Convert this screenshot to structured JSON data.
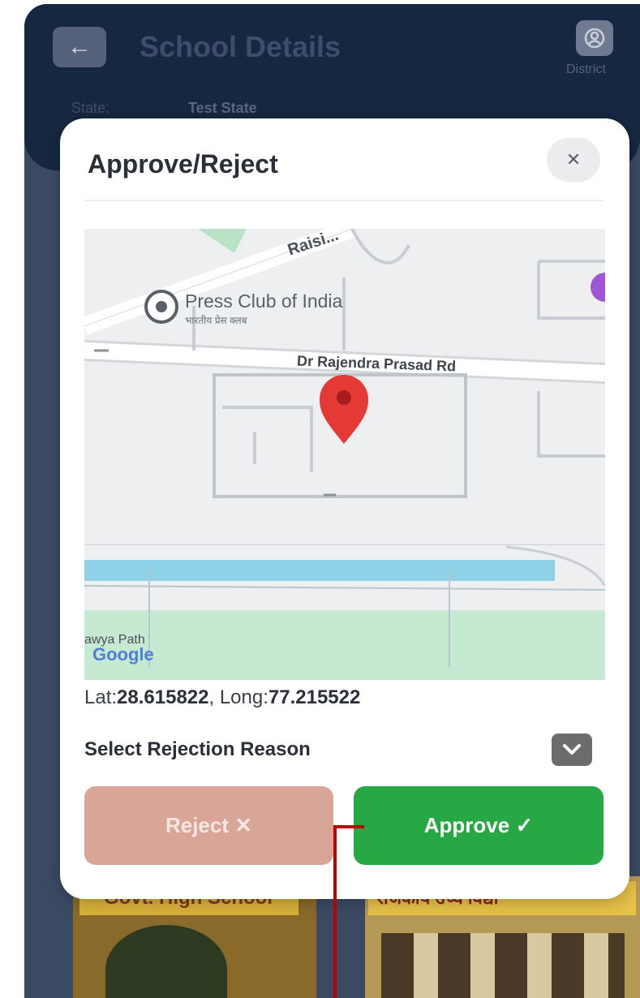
{
  "header": {
    "back_icon": "arrow-left-icon",
    "title": "School Details",
    "district_icon": "user-circle-icon",
    "district_label": "District",
    "state_label": "State:",
    "state_value": "Test State"
  },
  "background_photos": {
    "photo1_sign": "Govt. High School",
    "photo2_sign": "राजकीय उच्च विद्या"
  },
  "modal": {
    "title": "Approve/Reject",
    "close_icon": "close-icon",
    "map": {
      "labels": {
        "road_top": "Raisi...",
        "place": "Press Club of India",
        "place_hindi": "भारतीय प्रेस क्लब",
        "road_main": "Dr Rajendra Prasad Rd",
        "bottom_left": "awya Path"
      },
      "logo": "Google",
      "marker_icon": "map-pin-icon"
    },
    "coords": {
      "lat_label": "Lat:",
      "lat_value": "28.615822",
      "long_label": ", Long:",
      "long_value": "77.215522"
    },
    "reason": {
      "label": "Select Rejection Reason",
      "toggle_icon": "chevron-down-icon"
    },
    "buttons": {
      "reject": "Reject ✕",
      "approve": "Approve ✓"
    }
  },
  "colors": {
    "header_bg": "#162741",
    "approve": "#28a745",
    "reject": "#d9a597",
    "pointer": "#c00000"
  }
}
